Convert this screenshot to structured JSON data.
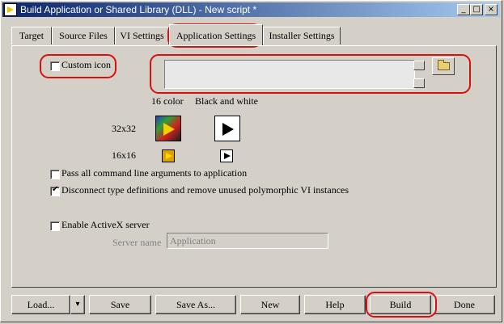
{
  "window": {
    "title": "Build Application or Shared Library (DLL) - New script *",
    "controls": [
      "_",
      "□",
      "×"
    ]
  },
  "tabs": [
    {
      "label": "Target",
      "active": false
    },
    {
      "label": "Source Files",
      "active": false
    },
    {
      "label": "VI Settings",
      "active": false
    },
    {
      "label": "Application Settings",
      "active": true
    },
    {
      "label": "Installer Settings",
      "active": false
    }
  ],
  "icon_section": {
    "custom_icon_label": "Custom icon",
    "custom_icon_checked": false,
    "icon_path_value": "",
    "col_16color": "16 color",
    "col_bw": "Black and white",
    "row_32": "32x32",
    "row_16": "16x16"
  },
  "options": [
    {
      "label": "Pass all command line arguments to application",
      "checked": false
    },
    {
      "label": "Disconnect type definitions and remove unused polymorphic VI instances",
      "checked": true
    }
  ],
  "activex": {
    "enable_label": "Enable ActiveX server",
    "enabled": false,
    "server_name_label": "Server name",
    "server_name_value": "Application"
  },
  "buttons": {
    "load": "Load...",
    "load_dropdown": "▾",
    "save": "Save",
    "save_as": "Save As...",
    "new": "New",
    "help": "Help",
    "build": "Build",
    "done": "Done"
  },
  "icons": {
    "folder": "folder-open-icon",
    "vi_icon": "vi-icon"
  },
  "colors": {
    "title_start": "#0a246a",
    "title_end": "#a6caf0",
    "highlight": "#d81010",
    "face": "#d4d0c8"
  }
}
